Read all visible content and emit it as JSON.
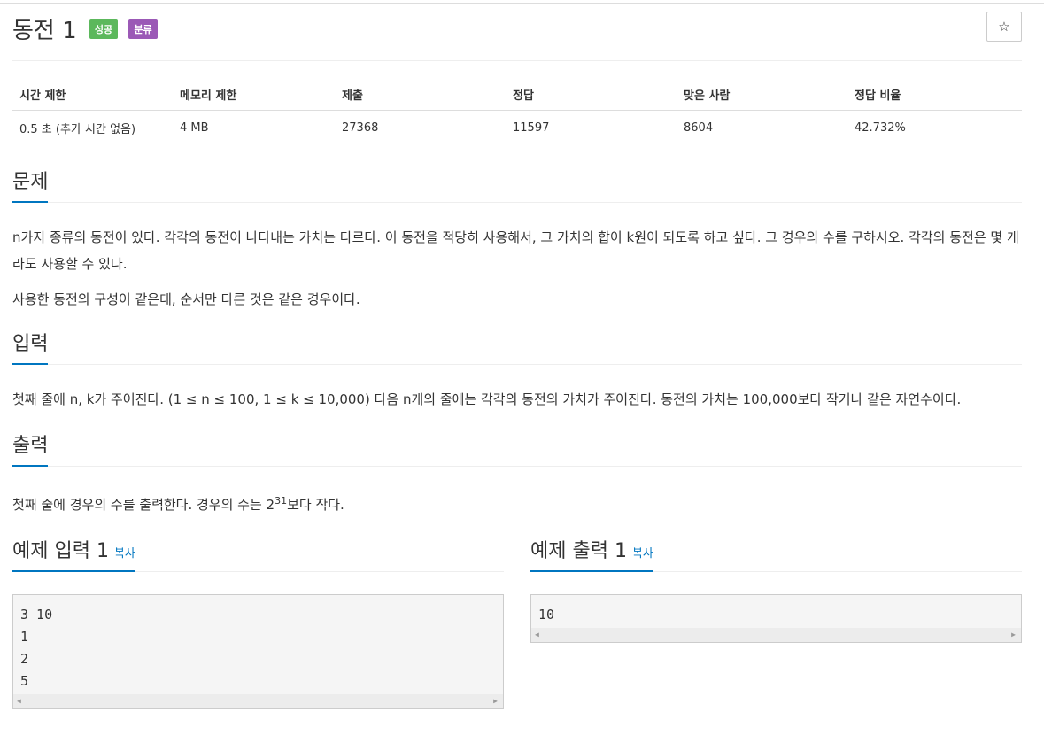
{
  "problem": {
    "title": "동전 1",
    "badges": {
      "success": "성공",
      "category": "분류"
    },
    "star_icon": "☆"
  },
  "info_table": {
    "headers": [
      "시간 제한",
      "메모리 제한",
      "제출",
      "정답",
      "맞은 사람",
      "정답 비율"
    ],
    "row": [
      "0.5 초 (추가 시간 없음)",
      "4 MB",
      "27368",
      "11597",
      "8604",
      "42.732%"
    ]
  },
  "sections": {
    "problem": {
      "heading": "문제",
      "paragraphs": [
        "n가지 종류의 동전이 있다. 각각의 동전이 나타내는 가치는 다르다. 이 동전을 적당히 사용해서, 그 가치의 합이 k원이 되도록 하고 싶다. 그 경우의 수를 구하시오. 각각의 동전은 몇 개라도 사용할 수 있다.",
        "사용한 동전의 구성이 같은데, 순서만 다른 것은 같은 경우이다."
      ]
    },
    "input": {
      "heading": "입력",
      "text": "첫째 줄에 n, k가 주어진다. (1 ≤ n ≤ 100, 1 ≤ k ≤ 10,000) 다음 n개의 줄에는 각각의 동전의 가치가 주어진다. 동전의 가치는 100,000보다 작거나 같은 자연수이다."
    },
    "output": {
      "heading": "출력",
      "text_before": "첫째 줄에 경우의 수를 출력한다. 경우의 수는 2",
      "sup": "31",
      "text_after": "보다 작다."
    }
  },
  "samples": {
    "input": {
      "heading": "예제 입력 1",
      "copy_label": "복사",
      "lines": "3 10\n1\n2\n5"
    },
    "output": {
      "heading": "예제 출력 1",
      "copy_label": "복사",
      "lines": "10"
    }
  },
  "scroll": {
    "left_arrow": "◀",
    "right_arrow": "▶"
  }
}
